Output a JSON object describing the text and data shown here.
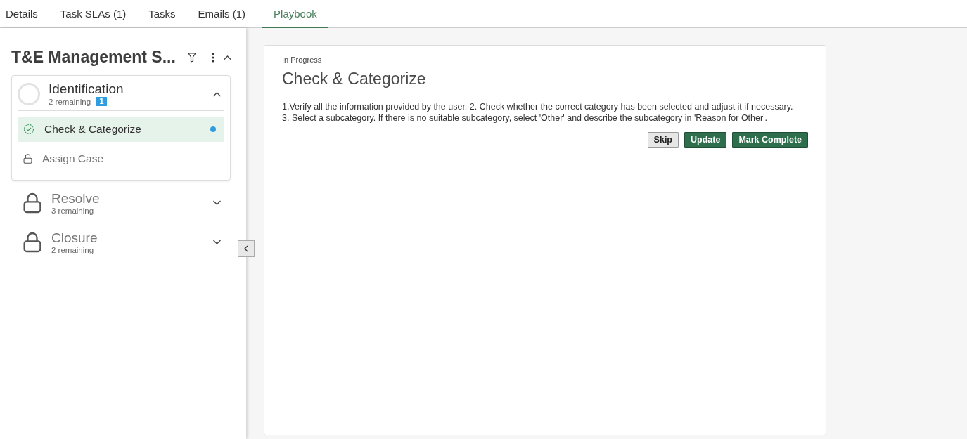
{
  "tabs": [
    {
      "label": "Details",
      "selected": false
    },
    {
      "label": "Task SLAs (1)",
      "selected": false
    },
    {
      "label": "Tasks",
      "selected": false
    },
    {
      "label": "Emails (1)",
      "selected": false
    },
    {
      "label": "Playbook",
      "selected": true
    }
  ],
  "playbook": {
    "title": "T&E Management S...",
    "expanded": true,
    "stages": [
      {
        "name": "Identification",
        "remaining": "2 remaining",
        "badge": "1",
        "locked": false,
        "expanded": true,
        "steps": [
          {
            "name": "Check & Categorize",
            "locked": false,
            "selected": true,
            "in_progress": true
          },
          {
            "name": "Assign Case",
            "locked": true,
            "selected": false,
            "in_progress": false
          }
        ]
      },
      {
        "name": "Resolve",
        "remaining": "3 remaining",
        "locked": true,
        "expanded": false
      },
      {
        "name": "Closure",
        "remaining": "2 remaining",
        "locked": true,
        "expanded": false
      }
    ]
  },
  "step_detail": {
    "status": "In Progress",
    "title": "Check & Categorize",
    "description": "1.Verify all the information provided by the user. 2. Check whether the correct category has been selected and adjust it if necessary. 3. Select a subcategory. If there is no suitable subcategory, select 'Other' and describe the subcategory in 'Reason for Other'.",
    "buttons": [
      {
        "label": "Skip",
        "kind": "secondary"
      },
      {
        "label": "Update",
        "kind": "primary"
      },
      {
        "label": "Mark Complete",
        "kind": "primary"
      }
    ]
  }
}
